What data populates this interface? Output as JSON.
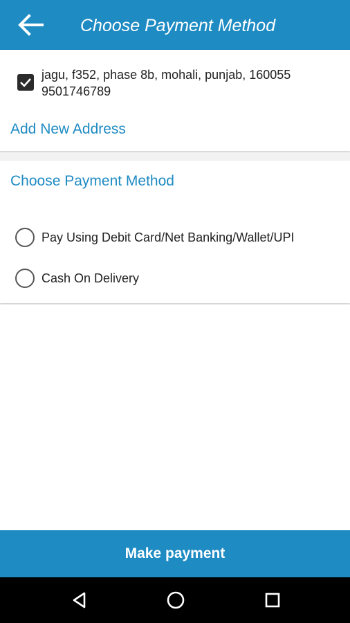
{
  "header": {
    "title": "Choose Payment Method",
    "back_icon": "arrow-left-icon",
    "color": "#1e8bc3"
  },
  "address": {
    "selected": true,
    "line1": "jagu, f352, phase 8b, mohali, punjab, 160055",
    "phone": "9501746789",
    "add_new_label": "Add New Address"
  },
  "payment": {
    "section_title": "Choose Payment Method",
    "options": [
      {
        "label": "Pay Using Debit Card/Net Banking/Wallet/UPI",
        "selected": false
      },
      {
        "label": "Cash On Delivery",
        "selected": false
      }
    ]
  },
  "footer": {
    "button_label": "Make payment"
  },
  "system_nav": {
    "back_icon": "triangle-back-icon",
    "home_icon": "circle-home-icon",
    "recent_icon": "square-recents-icon"
  },
  "colors": {
    "accent": "#1e8bc3",
    "nav_bg": "#000000"
  }
}
